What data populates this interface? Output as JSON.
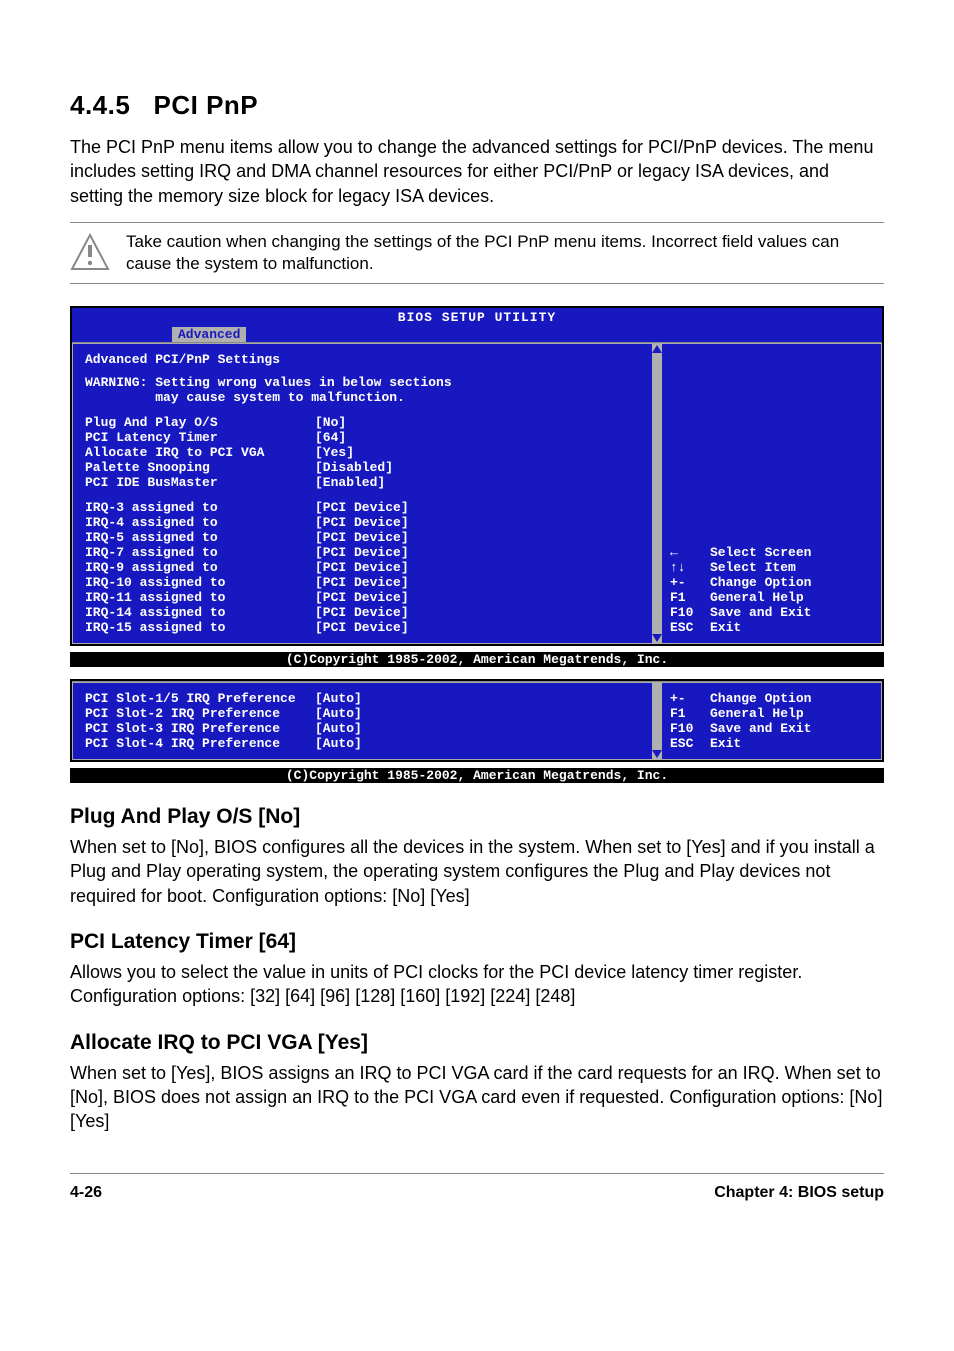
{
  "section": {
    "number": "4.4.5",
    "title": "PCI PnP",
    "intro": "The PCI PnP menu items allow you to change the advanced settings for PCI/PnP devices. The menu includes setting IRQ and DMA channel resources for either PCI/PnP or legacy ISA devices, and setting the memory size block for legacy ISA devices.",
    "caution": "Take caution when changing the settings of the PCI PnP menu items. Incorrect field values can cause the system to malfunction."
  },
  "bios1": {
    "title": "BIOS SETUP UTILITY",
    "tab": "Advanced",
    "heading": "Advanced PCI/PnP Settings",
    "warning": "WARNING: Setting wrong values in below sections\n         may cause system to malfunction.",
    "settingsA": [
      {
        "label": "Plug And Play O/S",
        "value": "[No]"
      },
      {
        "label": "PCI Latency Timer",
        "value": "[64]"
      },
      {
        "label": "Allocate IRQ to PCI VGA",
        "value": "[Yes]"
      },
      {
        "label": "Palette Snooping",
        "value": "[Disabled]"
      },
      {
        "label": "PCI IDE BusMaster",
        "value": "[Enabled]"
      }
    ],
    "settingsB": [
      {
        "label": "IRQ-3 assigned to",
        "value": "[PCI Device]"
      },
      {
        "label": "IRQ-4 assigned to",
        "value": "[PCI Device]"
      },
      {
        "label": "IRQ-5 assigned to",
        "value": "[PCI Device]"
      },
      {
        "label": "IRQ-7 assigned to",
        "value": "[PCI Device]"
      },
      {
        "label": "IRQ-9 assigned to",
        "value": "[PCI Device]"
      },
      {
        "label": "IRQ-10 assigned to",
        "value": "[PCI Device]"
      },
      {
        "label": "IRQ-11 assigned to",
        "value": "[PCI Device]"
      },
      {
        "label": "IRQ-14 assigned to",
        "value": "[PCI Device]"
      },
      {
        "label": "IRQ-15 assigned to",
        "value": "[PCI Device]"
      }
    ],
    "help": [
      {
        "key": "←",
        "text": "Select Screen"
      },
      {
        "key": "↑↓",
        "text": "Select Item"
      },
      {
        "key": "+-",
        "text": "Change Option"
      },
      {
        "key": "F1",
        "text": "General Help"
      },
      {
        "key": "F10",
        "text": "Save and Exit"
      },
      {
        "key": "ESC",
        "text": "Exit"
      }
    ],
    "copyright": "(C)Copyright 1985-2002, American Megatrends, Inc."
  },
  "bios2": {
    "settings": [
      {
        "label": "PCI Slot-1/5 IRQ Preference",
        "value": "[Auto]"
      },
      {
        "label": "PCI Slot-2 IRQ Preference",
        "value": "[Auto]"
      },
      {
        "label": "PCI Slot-3 IRQ Preference",
        "value": "[Auto]"
      },
      {
        "label": "PCI Slot-4 IRQ Preference",
        "value": "[Auto]"
      }
    ],
    "help": [
      {
        "key": "+-",
        "text": "Change Option"
      },
      {
        "key": "F1",
        "text": "General Help"
      },
      {
        "key": "F10",
        "text": "Save and Exit"
      },
      {
        "key": "ESC",
        "text": "Exit"
      }
    ],
    "copyright": "(C)Copyright 1985-2002, American Megatrends, Inc."
  },
  "subsections": [
    {
      "title": "Plug And Play O/S [No]",
      "body": "When set to [No], BIOS configures all the devices in the system. When set to [Yes] and if you install a Plug and Play operating system, the operating system configures the Plug and Play devices not required for boot. Configuration options: [No] [Yes]"
    },
    {
      "title": "PCI Latency Timer [64]",
      "body": "Allows you to select the value in units of PCI clocks for the PCI device latency timer register. Configuration options: [32] [64] [96] [128] [160] [192] [224] [248]"
    },
    {
      "title": "Allocate IRQ to PCI VGA [Yes]",
      "body": "When set to [Yes], BIOS assigns an IRQ to PCI VGA card if the card requests for an IRQ. When set to [No], BIOS does not assign an IRQ to the PCI VGA card even if requested. Configuration options: [No] [Yes]"
    }
  ],
  "footer": {
    "left": "4-26",
    "right": "Chapter 4: BIOS setup"
  }
}
